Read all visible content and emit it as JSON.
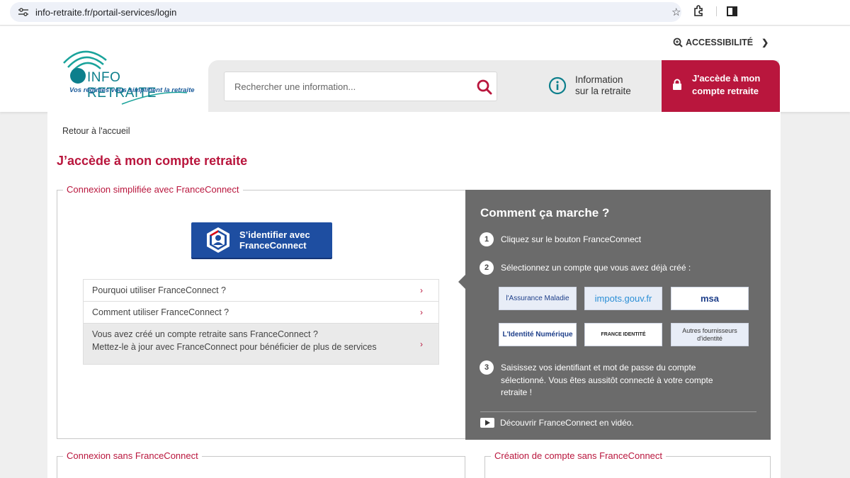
{
  "browser": {
    "url": "info-retraite.fr/portail-services/login"
  },
  "header": {
    "logo_name": "INFO RETRAITE",
    "logo_tagline": "Vos régimes vous simplifient la retraite",
    "accessibility_label": "ACCESSIBILITÉ",
    "search_placeholder": "Rechercher une information...",
    "info_line1": "Information",
    "info_line2": "sur la retraite",
    "account_line1": "J'accède à mon",
    "account_line2": "compte retraite",
    "accent_color": "#b9163d"
  },
  "main": {
    "breadcrumb": "Retour à l'accueil",
    "title": "J’accède à mon compte retraite",
    "fc_legend": "Connexion simplifiée avec FranceConnect",
    "fc_button_line1": "S’identifier avec",
    "fc_button_line2": "FranceConnect",
    "faq": [
      {
        "label": "Pourquoi utiliser FranceConnect ?"
      },
      {
        "label": "Comment utiliser FranceConnect ?"
      },
      {
        "line1": "Vous avez créé un compte retraite sans FranceConnect ?",
        "line2": "Mettez-le à jour avec FranceConnect pour bénéficier de plus de services"
      }
    ],
    "how": {
      "title": "Comment ça marche ?",
      "steps": [
        {
          "num": "1",
          "text": "Cliquez sur le bouton FranceConnect"
        },
        {
          "num": "2",
          "text": "Sélectionnez un compte que vous avez déjà créé :"
        },
        {
          "num": "3",
          "line1": "Saisissez vos identifiant et mot de passe du compte",
          "line2": "sélectionné. Vous êtes aussitôt connecté à votre compte",
          "line3": "retraite !"
        }
      ],
      "providers": [
        {
          "name": "l'Assurance Maladie"
        },
        {
          "name": "impots.gouv.fr"
        },
        {
          "name": "msa"
        },
        {
          "name": "L'Identité Numérique"
        },
        {
          "name": "FRANCE IDENTITÉ"
        },
        {
          "line1": "Autres fournisseurs",
          "line2": "d'identité"
        }
      ],
      "video_label": "Découvrir FranceConnect en vidéo."
    },
    "bottom_left_legend": "Connexion sans FranceConnect",
    "bottom_right_legend": "Création de compte sans FranceConnect"
  }
}
